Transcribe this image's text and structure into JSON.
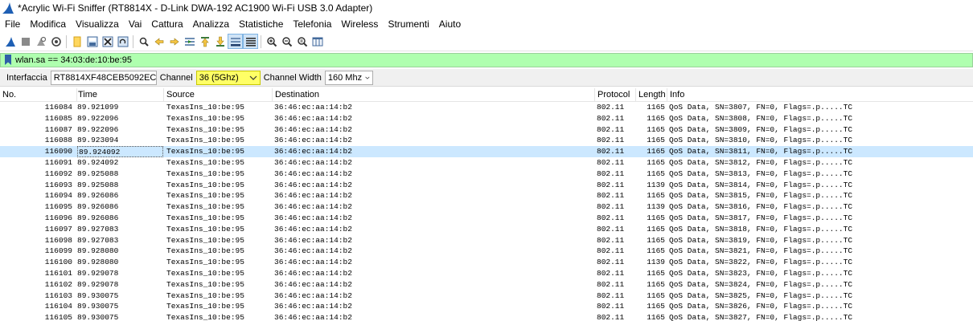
{
  "window": {
    "title": "*Acrylic Wi-Fi Sniffer (RT8814X - D-Link DWA-192 AC1900 Wi-Fi USB 3.0 Adapter)"
  },
  "menu": {
    "items": [
      "File",
      "Modifica",
      "Visualizza",
      "Vai",
      "Cattura",
      "Analizza",
      "Statistiche",
      "Telefonia",
      "Wireless",
      "Strumenti",
      "Aiuto"
    ]
  },
  "toolbar": {
    "icons": [
      "shark-fin-start-icon",
      "stop-icon",
      "restart-icon",
      "capture-options-icon",
      "open-file-icon",
      "save-file-icon",
      "close-file-icon",
      "reload-icon",
      "find-packet-icon",
      "go-back-icon",
      "go-forward-icon",
      "go-to-packet-icon",
      "go-first-icon",
      "go-last-icon",
      "autoscroll-icon",
      "colorize-icon",
      "zoom-in-icon",
      "zoom-out-icon",
      "zoom-normal-icon",
      "resize-columns-icon"
    ]
  },
  "filter": {
    "value": "wlan.sa == 34:03:de:10:be:95",
    "bg_color": "#afffaf"
  },
  "interface_bar": {
    "interface_label": "Interfaccia",
    "interface_value": "RT8814XF48CEB5092EC",
    "channel_label": "Channel",
    "channel_value": "36 (5Ghz)",
    "channel_width_label": "Channel Width",
    "channel_width_value": "160 Mhz",
    "highlight_color": "#ffff66"
  },
  "packet_list": {
    "columns": {
      "no": "No.",
      "time": "Time",
      "source": "Source",
      "destination": "Destination",
      "protocol": "Protocol",
      "length": "Length",
      "info": "Info"
    },
    "selected_index": 6,
    "selected_color": "#cce8ff",
    "rows": [
      {
        "no": "116084",
        "time": "89.921099",
        "source": "TexasIns_10:be:95",
        "destination": "36:46:ec:aa:14:b2",
        "protocol": "802.11",
        "length": "1165",
        "info": "QoS Data, SN=3807, FN=0, Flags=.p.....TC"
      },
      {
        "no": "116085",
        "time": "89.922096",
        "source": "TexasIns_10:be:95",
        "destination": "36:46:ec:aa:14:b2",
        "protocol": "802.11",
        "length": "1165",
        "info": "QoS Data, SN=3808, FN=0, Flags=.p.....TC"
      },
      {
        "no": "116087",
        "time": "89.922096",
        "source": "TexasIns_10:be:95",
        "destination": "36:46:ec:aa:14:b2",
        "protocol": "802.11",
        "length": "1165",
        "info": "QoS Data, SN=3809, FN=0, Flags=.p.....TC"
      },
      {
        "no": "116088",
        "time": "89.923094",
        "source": "TexasIns_10:be:95",
        "destination": "36:46:ec:aa:14:b2",
        "protocol": "802.11",
        "length": "1165",
        "info": "QoS Data, SN=3810, FN=0, Flags=.p.....TC"
      },
      {
        "no": "116090",
        "time": "89.924092",
        "source": "TexasIns_10:be:95",
        "destination": "36:46:ec:aa:14:b2",
        "protocol": "802.11",
        "length": "1165",
        "info": "QoS Data, SN=3811, FN=0, Flags=.p.....TC"
      },
      {
        "no": "116091",
        "time": "89.924092",
        "source": "TexasIns_10:be:95",
        "destination": "36:46:ec:aa:14:b2",
        "protocol": "802.11",
        "length": "1165",
        "info": "QoS Data, SN=3812, FN=0, Flags=.p.....TC"
      },
      {
        "no": "116092",
        "time": "89.925088",
        "source": "TexasIns_10:be:95",
        "destination": "36:46:ec:aa:14:b2",
        "protocol": "802.11",
        "length": "1165",
        "info": "QoS Data, SN=3813, FN=0, Flags=.p.....TC"
      },
      {
        "no": "116093",
        "time": "89.925088",
        "source": "TexasIns_10:be:95",
        "destination": "36:46:ec:aa:14:b2",
        "protocol": "802.11",
        "length": "1139",
        "info": "QoS Data, SN=3814, FN=0, Flags=.p.....TC"
      },
      {
        "no": "116094",
        "time": "89.926086",
        "source": "TexasIns_10:be:95",
        "destination": "36:46:ec:aa:14:b2",
        "protocol": "802.11",
        "length": "1165",
        "info": "QoS Data, SN=3815, FN=0, Flags=.p.....TC"
      },
      {
        "no": "116095",
        "time": "89.926086",
        "source": "TexasIns_10:be:95",
        "destination": "36:46:ec:aa:14:b2",
        "protocol": "802.11",
        "length": "1139",
        "info": "QoS Data, SN=3816, FN=0, Flags=.p.....TC"
      },
      {
        "no": "116096",
        "time": "89.926086",
        "source": "TexasIns_10:be:95",
        "destination": "36:46:ec:aa:14:b2",
        "protocol": "802.11",
        "length": "1165",
        "info": "QoS Data, SN=3817, FN=0, Flags=.p.....TC"
      },
      {
        "no": "116097",
        "time": "89.927083",
        "source": "TexasIns_10:be:95",
        "destination": "36:46:ec:aa:14:b2",
        "protocol": "802.11",
        "length": "1165",
        "info": "QoS Data, SN=3818, FN=0, Flags=.p.....TC"
      },
      {
        "no": "116098",
        "time": "89.927083",
        "source": "TexasIns_10:be:95",
        "destination": "36:46:ec:aa:14:b2",
        "protocol": "802.11",
        "length": "1165",
        "info": "QoS Data, SN=3819, FN=0, Flags=.p.....TC"
      },
      {
        "no": "116099",
        "time": "89.928080",
        "source": "TexasIns_10:be:95",
        "destination": "36:46:ec:aa:14:b2",
        "protocol": "802.11",
        "length": "1165",
        "info": "QoS Data, SN=3821, FN=0, Flags=.p.....TC"
      },
      {
        "no": "116100",
        "time": "89.928080",
        "source": "TexasIns_10:be:95",
        "destination": "36:46:ec:aa:14:b2",
        "protocol": "802.11",
        "length": "1139",
        "info": "QoS Data, SN=3822, FN=0, Flags=.p.....TC"
      },
      {
        "no": "116101",
        "time": "89.929078",
        "source": "TexasIns_10:be:95",
        "destination": "36:46:ec:aa:14:b2",
        "protocol": "802.11",
        "length": "1165",
        "info": "QoS Data, SN=3823, FN=0, Flags=.p.....TC"
      },
      {
        "no": "116102",
        "time": "89.929078",
        "source": "TexasIns_10:be:95",
        "destination": "36:46:ec:aa:14:b2",
        "protocol": "802.11",
        "length": "1165",
        "info": "QoS Data, SN=3824, FN=0, Flags=.p.....TC"
      },
      {
        "no": "116103",
        "time": "89.930075",
        "source": "TexasIns_10:be:95",
        "destination": "36:46:ec:aa:14:b2",
        "protocol": "802.11",
        "length": "1165",
        "info": "QoS Data, SN=3825, FN=0, Flags=.p.....TC"
      },
      {
        "no": "116104",
        "time": "89.930075",
        "source": "TexasIns_10:be:95",
        "destination": "36:46:ec:aa:14:b2",
        "protocol": "802.11",
        "length": "1165",
        "info": "QoS Data, SN=3826, FN=0, Flags=.p.....TC"
      },
      {
        "no": "116105",
        "time": "89.930075",
        "source": "TexasIns_10:be:95",
        "destination": "36:46:ec:aa:14:b2",
        "protocol": "802.11",
        "length": "1165",
        "info": "QoS Data, SN=3827, FN=0, Flags=.p.....TC"
      }
    ]
  }
}
